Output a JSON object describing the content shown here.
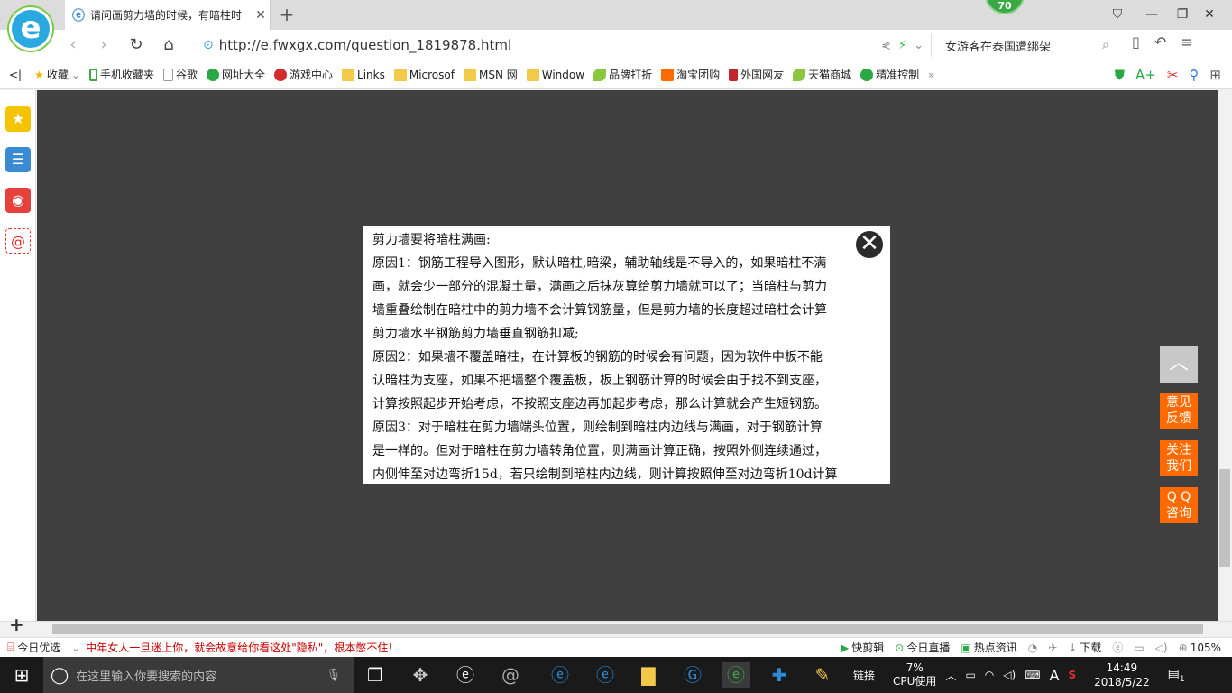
{
  "tab": {
    "title": "请问画剪力墙的时候，有暗柱时",
    "close": "✕",
    "new": "+"
  },
  "badge": {
    "count": "70"
  },
  "window": {
    "min": "—",
    "max": "❐",
    "close": "✕",
    "skin": "⛉"
  },
  "logo": {
    "letter": "e"
  },
  "nav": {
    "url": "http://e.fwxgx.com/question_1819878.html",
    "search_value": "女游客在泰国遭绑架"
  },
  "favorites": [
    "收藏",
    "手机收藏夹",
    "谷歌",
    "网址大全",
    "游戏中心",
    "Links",
    "Microsof",
    "MSN 网",
    "Window",
    "品牌打折",
    "淘宝团购",
    "外国网友",
    "天猫商城",
    "精准控制"
  ],
  "popup": {
    "lines": [
      "剪力墙要将暗柱满画:",
      "原因1：钢筋工程导入图形，默认暗柱,暗梁，辅助轴线是不导入的，如果暗柱不满",
      "画，就会少一部分的混凝土量，满画之后抹灰算给剪力墙就可以了；当暗柱与剪力",
      "墙重叠绘制在暗柱中的剪力墙不会计算钢筋量，但是剪力墙的长度超过暗柱会计算",
      "剪力墙水平钢筋剪力墙垂直钢筋扣减;",
      "原因2：如果墙不覆盖暗柱，在计算板的钢筋的时候会有问题，因为软件中板不能",
      "认暗柱为支座，如果不把墙整个覆盖板，板上钢筋计算的时候会由于找不到支座，",
      "计算按照起步开始考虑，不按照支座边再加起步考虑，那么计算就会产生短钢筋。",
      "原因3：对于暗柱在剪力墙端头位置，则绘制到暗柱内边线与满画，对于钢筋计算",
      "是一样的。但对于暗柱在剪力墙转角位置，则满画计算正确，按照外侧连续通过，",
      "内侧伸至对边弯折15d，若只绘制到暗柱内边线，则计算按照伸至对边弯折10d计算"
    ],
    "close": "✕"
  },
  "float_buttons": {
    "top": "︿",
    "feedback_1": "意见",
    "feedback_2": "反馈",
    "follow_1": "关注",
    "follow_2": "我们",
    "qq_1": "Q Q",
    "qq_2": "咨询"
  },
  "status": {
    "today": "今日优选",
    "news": "中年女人一旦迷上你，就会故意给你看这处\"隐私\"，根本憋不住!",
    "clip": "快剪辑",
    "live": "今日直播",
    "hot": "热点资讯",
    "download": "下载",
    "zoom": "105%"
  },
  "taskbar": {
    "search_placeholder": "在这里输入你要搜索的内容",
    "link": "链接",
    "cpu_pct": "7%",
    "cpu_label": "CPU使用",
    "ime": "A",
    "time": "14:49",
    "date": "2018/5/22",
    "notif": "1"
  },
  "colors": {
    "accent": "#ff6a00",
    "content_bg": "#404040"
  }
}
